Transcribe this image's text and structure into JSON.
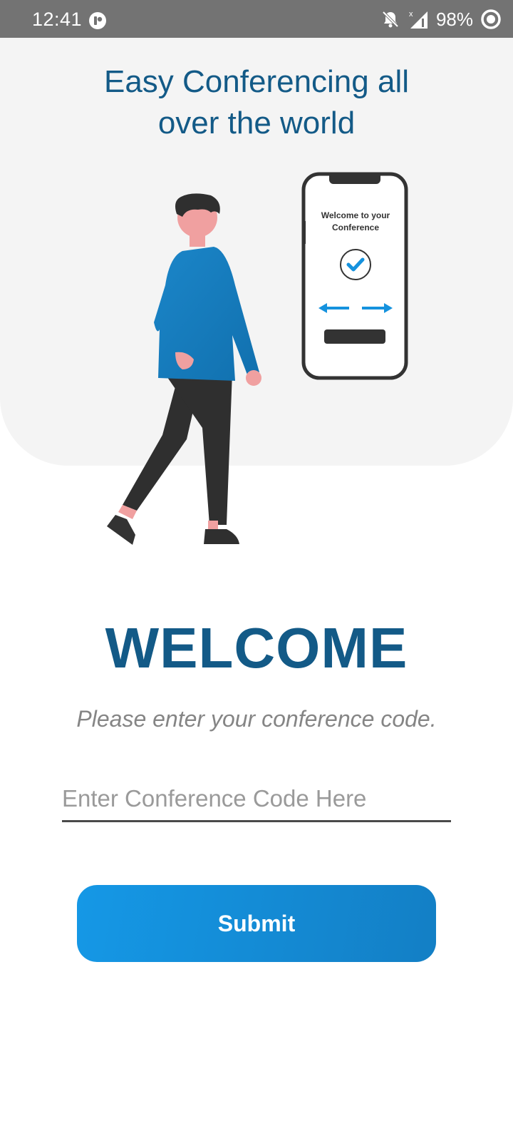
{
  "status_bar": {
    "time": "12:41",
    "battery": "98%",
    "icons": [
      "app-notification-icon",
      "bell-off-icon",
      "signal-icon",
      "battery-ring-icon"
    ]
  },
  "header": {
    "headline_line1": "Easy Conferencing all",
    "headline_line2": "over the world"
  },
  "illustration": {
    "phone_text_line1": "Welcome to your",
    "phone_text_line2": "Conference",
    "icons": [
      "person-illustration",
      "phone-illustration",
      "check-circle-icon",
      "arrow-left-icon",
      "arrow-right-icon"
    ]
  },
  "welcome": {
    "title": "WELCOME",
    "subtitle": "Please enter your conference code."
  },
  "form": {
    "code_placeholder": "Enter Conference Code Here",
    "code_value": "",
    "submit_label": "Submit"
  },
  "colors": {
    "primary": "#135a87",
    "accent": "#1598e6",
    "status_bar": "#737373",
    "header_bg": "#f4f4f4"
  }
}
